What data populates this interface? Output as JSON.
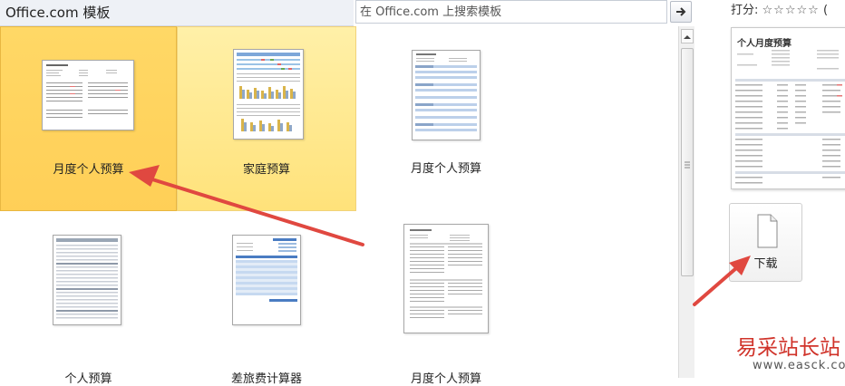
{
  "header": {
    "title": "Office.com 模板"
  },
  "search": {
    "placeholder": "在 Office.com 上搜索模板"
  },
  "templates": [
    {
      "label": "月度个人预算"
    },
    {
      "label": "家庭预算"
    },
    {
      "label": "月度个人预算"
    },
    {
      "label": "个人预算"
    },
    {
      "label": "差旅费计算器"
    },
    {
      "label": "月度个人预算"
    }
  ],
  "details": {
    "rating_label": "打分:",
    "stars": "☆☆☆☆☆",
    "rating_suffix": "(",
    "preview_title": "个人月度预算",
    "download_label": "下载"
  },
  "watermark": {
    "text": "易采站长站",
    "url": "www.easck.com"
  },
  "colors": {
    "selected": "#ffd866",
    "hover": "#ffe27a",
    "arrow": "#e04840",
    "watermark": "#d0332a"
  }
}
